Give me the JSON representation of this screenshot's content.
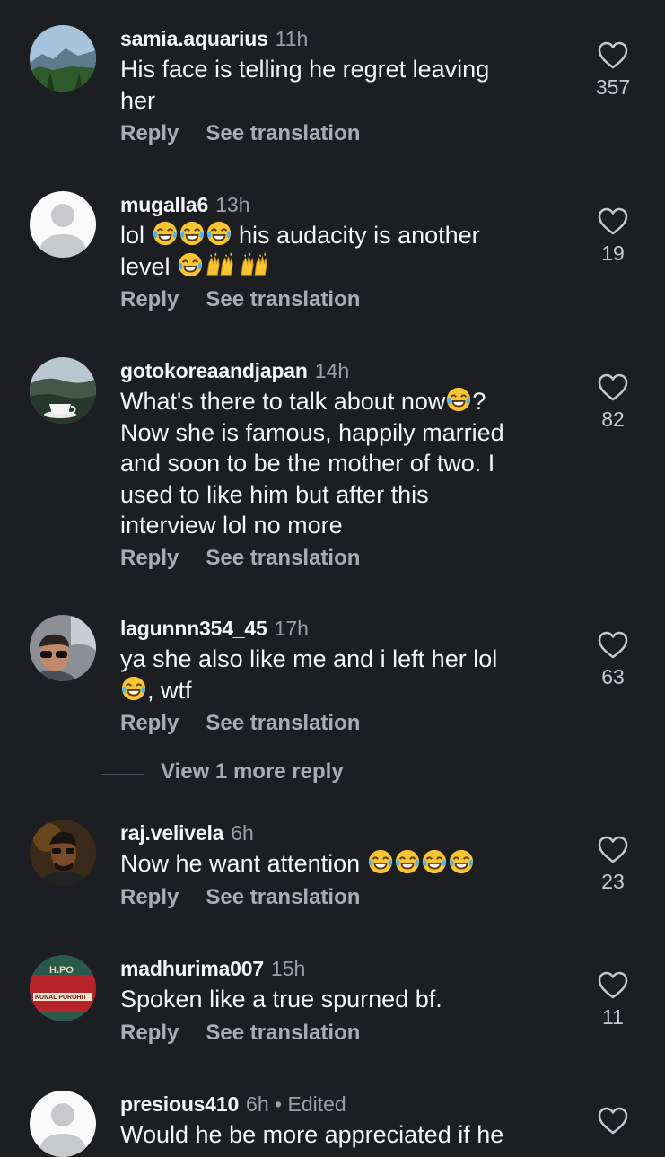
{
  "actions": {
    "reply": "Reply",
    "see_translation": "See translation"
  },
  "comments": [
    {
      "username": "samia.aquarius",
      "time": "11h",
      "text_lines": [
        "His face is telling he regret leaving",
        "her"
      ],
      "likes": "357"
    },
    {
      "username": "mugalla6",
      "time": "13h",
      "text_a": "lol ",
      "text_b": " his audacity is another",
      "text_c": "level ",
      "likes": "19"
    },
    {
      "username": "gotokoreaandjapan",
      "time": "14h",
      "text_a": "What's there to talk about now",
      "text_b": "?",
      "text_lines": [
        "Now she is famous, happily married",
        "and soon to be the mother of two.  I",
        "used to like him but after this",
        "interview lol no more"
      ],
      "likes": "82"
    },
    {
      "username": "lagunnn354_45",
      "time": "17h",
      "text_a": "ya she also like me and i left her lol",
      "text_b": ", wtf",
      "likes": "63"
    },
    {
      "username": "raj.velivela",
      "time": "6h",
      "text_a": "Now he want attention ",
      "likes": "23"
    },
    {
      "username": "madhurima007",
      "time": "15h",
      "text_a": "Spoken like a true spurned bf.",
      "likes": "11",
      "avatar_text": [
        "H.PO",
        "KUNAL PUROHIT"
      ]
    },
    {
      "username": "presious410",
      "time": "6h",
      "edited": " • Edited",
      "text_a": "Would he be more appreciated if he"
    }
  ],
  "view_more": "View 1 more reply",
  "icons": {
    "like": "heart-outline-icon",
    "laugh": "face-with-tears-of-joy-icon",
    "hands": "raising-hands-icon",
    "default_avatar": "default-avatar-icon"
  },
  "colors": {
    "background": "#1c1e22",
    "text": "#f3f5f7",
    "muted": "#a8adb3",
    "emoji": "#f7c531"
  }
}
